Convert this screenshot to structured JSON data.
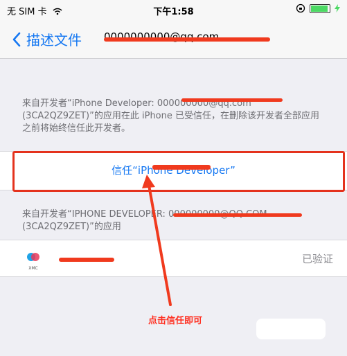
{
  "status_bar": {
    "carrier": "无 SIM 卡",
    "time": "下午1:58"
  },
  "nav": {
    "back_label": "描述文件",
    "title": "0000000000@qq.com"
  },
  "developer_section": {
    "note": "来自开发者“iPhone Developer: 000000000@qq.com (3CA2QZ9ZET)”的应用在此 iPhone 已受信任，在删除该开发者全部应用之前将始终信任此开发者。",
    "trust_button": "信任“iPhone Developer”"
  },
  "apps_section": {
    "header": "来自开发者“IPHONE DEVELOPER: 000000000@QQ.COM (3CA2QZ9ZET)”的应用",
    "app_name": "XMC",
    "icon_text": "XMC",
    "status": "已验证"
  },
  "annotation": {
    "hint": "点击信任即可"
  },
  "colors": {
    "accent": "#1678f2",
    "annotation": "#e4321d"
  }
}
